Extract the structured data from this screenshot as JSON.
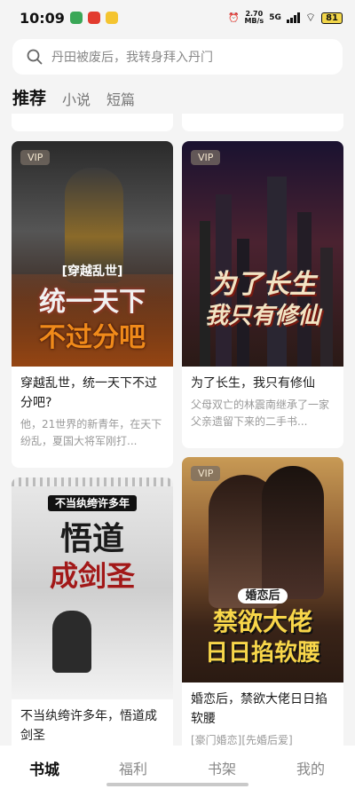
{
  "status_bar": {
    "time": "10:09",
    "net_speed": "2.70",
    "net_unit": "MB/s",
    "signal": "5G",
    "battery": "81"
  },
  "search": {
    "placeholder": "丹田被废后，我转身拜入丹门",
    "icon": "search-icon"
  },
  "tabs": [
    {
      "label": "推荐",
      "active": true
    },
    {
      "label": "小说"
    },
    {
      "label": "短篇"
    }
  ],
  "books": [
    {
      "vip": "VIP",
      "cover_tag": "[穿越乱世]",
      "cover_title_1": "统一天下",
      "cover_title_2": "不过分吧",
      "title": "穿越乱世，统一天下不过分吧?",
      "desc": "他，21世界的新青年，在天下纷乱，夏国大将军刚打..."
    },
    {
      "vip": "VIP",
      "cover_title_1": "为了长生",
      "cover_title_2": "我只有修仙",
      "title": "为了长生，我只有修仙",
      "desc": "父母双亡的林震南继承了一家父亲遗留下来的二手书..."
    },
    {
      "cover_tag": "不当纨绔许多年",
      "cover_title_1": "悟道",
      "cover_title_2": "成剑圣",
      "title": "不当纨绔许多年，悟道成剑圣"
    },
    {
      "vip": "VIP",
      "cover_tag": "婚恋后",
      "cover_title_1": "禁欲大佬",
      "cover_title_2": "日日掐软腰",
      "title": "婚恋后，禁欲大佬日日掐软腰",
      "desc": "[豪门婚恋][先婚后爱]"
    }
  ],
  "bottom_nav": [
    {
      "label": "书城",
      "active": true
    },
    {
      "label": "福利"
    },
    {
      "label": "书架"
    },
    {
      "label": "我的"
    }
  ]
}
